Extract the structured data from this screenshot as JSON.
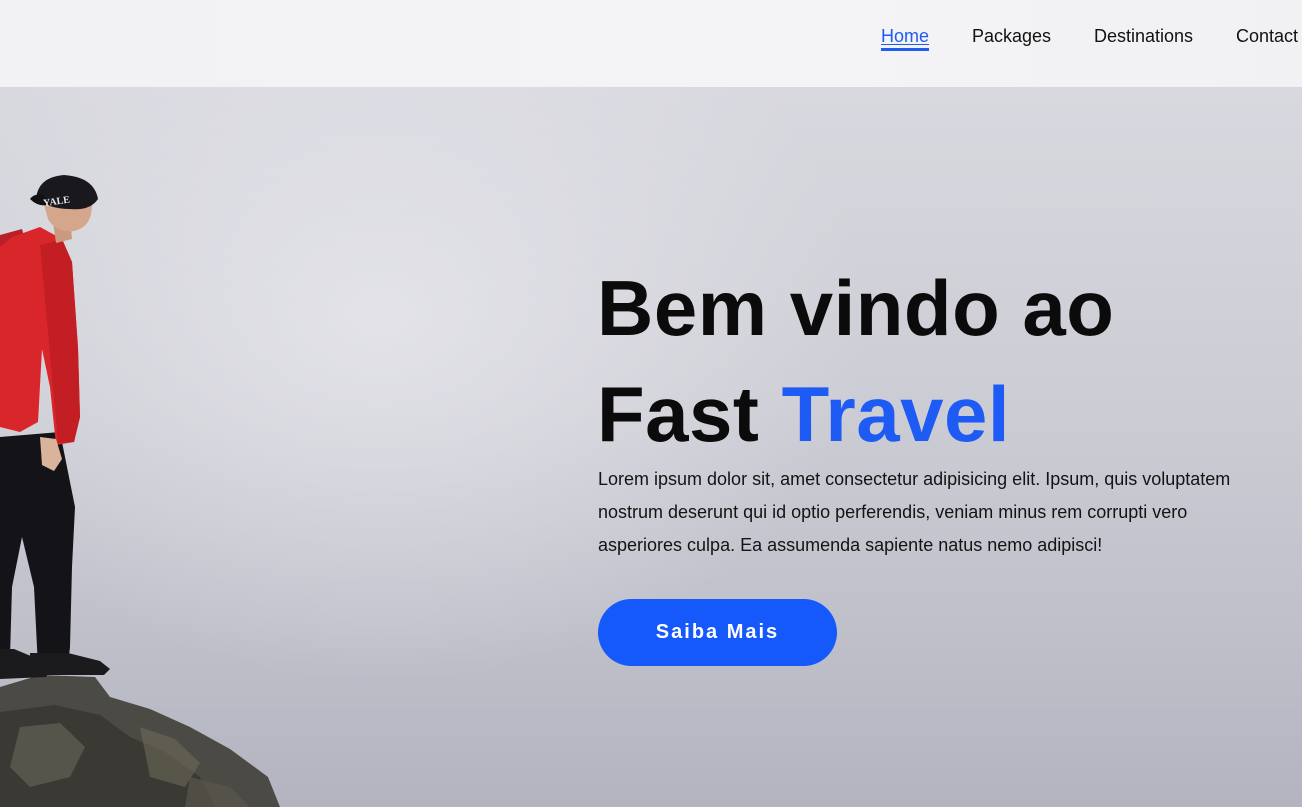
{
  "nav": {
    "home": "Home",
    "packages": "Packages",
    "destinations": "Destinations",
    "contact": "Contact",
    "active": "Home"
  },
  "hero": {
    "title_line1": "Bem vindo ao",
    "title_line2_prefix": "Fast ",
    "title_line2_accent": "Travel",
    "paragraph": "Lorem ipsum dolor sit, amet consectetur adipisicing elit. Ipsum, quis voluptatem nostrum deserunt qui id optio perferendis, veniam minus rem corrupti vero asperiores culpa. Ea assumenda sapiente natus nemo adipisci!",
    "cta_label": "Saiba Mais",
    "cap_text": "YALE"
  },
  "colors": {
    "accent": "#1d5bf4",
    "button": "#1659fb",
    "jacket": "#d9262a",
    "header_bg": "#f3f3f5"
  }
}
